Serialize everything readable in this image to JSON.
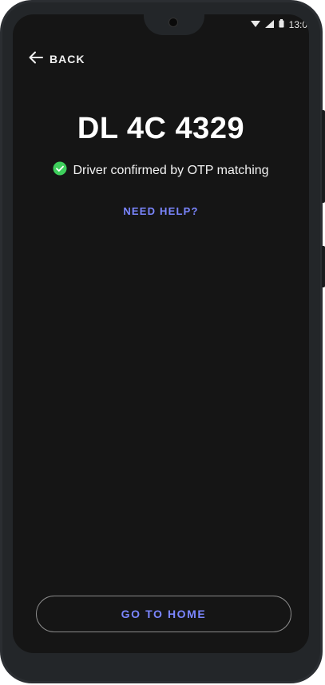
{
  "status_bar": {
    "time": "13:0",
    "icons": [
      "wifi-icon",
      "signal-icon",
      "battery-icon"
    ]
  },
  "header": {
    "back_label": "BACK",
    "back_icon": "arrow-left-icon"
  },
  "main": {
    "plate_number": "DL 4C 4329",
    "confirmation_text": "Driver confirmed by OTP matching",
    "confirmation_icon": "check-circle-icon",
    "help_link": "NEED HELP?"
  },
  "footer": {
    "home_button_label": "GO TO HOME"
  },
  "colors": {
    "background": "#151515",
    "accent": "#7b86ff",
    "success": "#3ecf5c",
    "text": "#ffffff",
    "button_border": "#8a8a8a"
  }
}
